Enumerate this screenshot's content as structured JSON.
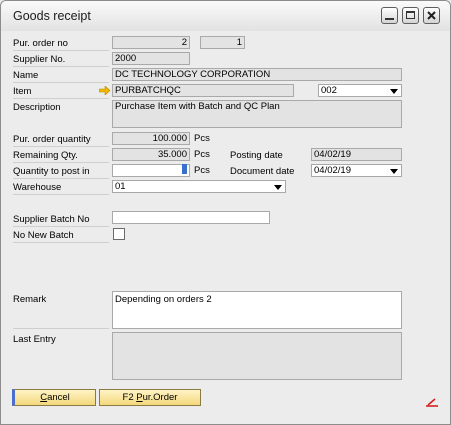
{
  "window": {
    "title": "Goods receipt"
  },
  "labels": {
    "pur_order_no": "Pur. order no",
    "supplier_no": "Supplier No.",
    "name": "Name",
    "item": "Item",
    "description": "Description",
    "pur_order_qty": "Pur. order quantity",
    "remaining_qty": "Remaining Qty.",
    "qty_to_post": "Quantity to post in",
    "warehouse": "Warehouse",
    "posting_date": "Posting date",
    "document_date": "Document date",
    "supplier_batch_no": "Supplier Batch No",
    "no_new_batch": "No New Batch",
    "remark": "Remark",
    "last_entry": "Last Entry"
  },
  "values": {
    "pur_order_no": "2",
    "pur_order_line": "1",
    "supplier_no": "2000",
    "name": "DC TECHNOLOGY CORPORATION",
    "item_code": "PURBATCHQC",
    "item_variant": "002",
    "description": "Purchase Item with Batch and QC Plan",
    "pur_order_qty": "100.000",
    "remaining_qty": "35.000",
    "qty_to_post": "",
    "warehouse": "01",
    "posting_date": "04/02/19",
    "document_date": "04/02/19",
    "supplier_batch_no": "",
    "remark": "Depending on orders 2",
    "last_entry": ""
  },
  "units": {
    "pcs": "Pcs"
  },
  "no_new_batch_checked": false,
  "buttons": {
    "cancel_prefix": "",
    "cancel_underline": "C",
    "cancel_rest": "ancel",
    "porder_prefix": "F2 ",
    "porder_underline": "P",
    "porder_rest": "ur.Order"
  },
  "icons": {
    "link_arrow": "link-arrow-icon",
    "minimize": "minimize-icon",
    "maximize": "maximize-icon",
    "close": "close-icon"
  },
  "colors": {
    "accent_button": "#f3d77c",
    "focus_border": "#4a6ed0",
    "link_arrow": "#f2b800",
    "corner_mark": "#d42020"
  }
}
